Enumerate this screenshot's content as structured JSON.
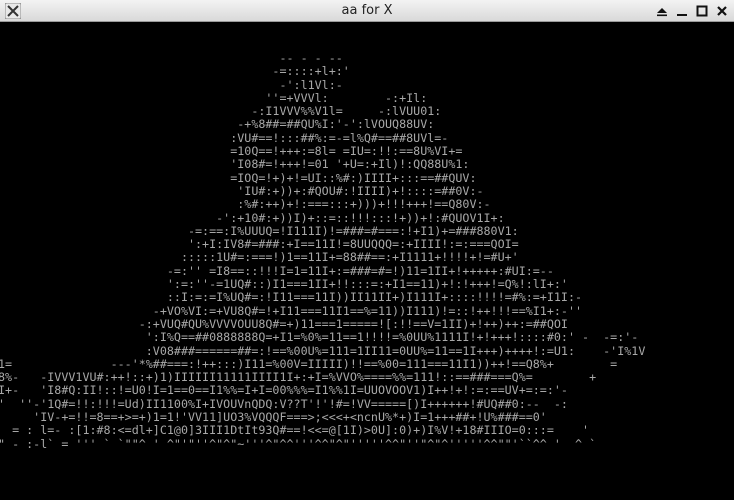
{
  "window": {
    "title": "aa for X",
    "icons": {
      "app": "x-logo-icon",
      "shade": "shade-icon",
      "minimize": "minimize-icon",
      "maximize": "maximize-icon",
      "close": "close-icon"
    }
  },
  "terminal": {
    "lines": [
      "                                        -- - - --",
      "                                       -=::::+l+:'",
      "                                        -':l1Vl:-",
      "                                      ''=+VVVl:        -:+Il:",
      "                                    -:I1VVV%%V1l=     -:lVUU01:",
      "                                  -+%8##=##QU%I:'-':lVOUQ88UV:",
      "                                 :VU#==!:::##%:=-=l%Q#==##8UVl=-",
      "                                 =10Q==!+++:=8l= =IU=:!!:==8U%VI+=",
      "                                 'I08#=!+++!=01 '+U=:+Il)!:QQ88U%1:",
      "                                 =IOQ=!+)+!=UI::%#:)IIII+:::==##QUV:",
      "                                  'IU#:+))+:#QOU#:!IIII)+!::::=##0V:-",
      "                                  :%#:++)+!:===:::+)))+!!!+++!==Q80V:-",
      "                               -':+10#:+))I)+::=::!!!:::!+))+!:#QUOV1I+:",
      "                           -=:==:I%UUUQ=!I111I)!=###=#===:!+I1)+=###880V1:",
      "                           ':+I:IV8#=###:+I==11I!=8UUQQQ=:+IIII!:=:===QOI=",
      "                          :::::1U#=:===!)1==11I+=88##==:+I1111+!!!!+!=#U+'",
      "                        -=:'' =I8==::!!!I=1=11I+:=###=#=!)11=1II+!+++++:#UI:=--",
      "                        ':=:''-=1UQ#::)I1===1II+!!:::=:+I1==11)+!:!+++!=Q%!:lI+:'",
      "                        ::I:=:=I%UQ#=:!I11===11I))II11II+)I111I+::::!!!!=#%:=+I1I:-",
      "                      -+VO%VI:=+VU8Q#=!+I11===11I1==%=11))I111)!=::!++!!!==%I1+:-''",
      "                    -:+VUQ#QU%VVVVOUU8Q#=+)11===1=====![:!!==V=1II)+!++)++:=##QOI",
      "                     ':I%Q==##0888888Q=+I1=%0%=11==1!!!!=%0UU%1111I!+!+++!::::#0:' -  -=:'-",
      "                     :V08###======##=:!==%00U%=111=1II11=0UU%=11==1I+++)++++!:=U1:    -'I%1V",
      "1=              ---'*%##===:!++:::)I11=%00V=IIIII)!!==%00=111===11I1))++!==Q8%+        =",
      "8%-   -IVVV1VU#:++!::+)1)IIIIII11111IIII1I+:+I=%VVO%====%%=111!::==###===Q%=        +",
      "I+-   'I8#Q:II!::!=U0!I=1==0==I1%%=I+I=00%%%=I1%%1I=UUOVOOV1)I++!+!:=:==UV+=:=:'-",
      "'  ''-'1Q#=!!:!!!=Ud)II1100%I+IVOUVnQDQ:V??T'!'!#=!VV=====[)I++++++!#UQ##0:--  -:",
      "     'IV-+=!!=8==+>=+)1=1!'VV11]UO3%VQQQF===>;<<<+<ncnU%*+)I=1+++##+!U%###==0'",
      "  = : l=- :[1:#8:<=dl+]C1@0]3III1DtIt93Q#==!<<=@[1I)>0U]:0)+)I%V!+18#IIIO=0:::=    '",
      "\" - :-l` = ''' ` `\"\"^ ' ^\"'\"''^\"^\"~'''^\"^^'''^^\"^\"'''''^^\"''\"^\"^'''''^^\"\"'``^^ '  ^ ` "
    ]
  }
}
